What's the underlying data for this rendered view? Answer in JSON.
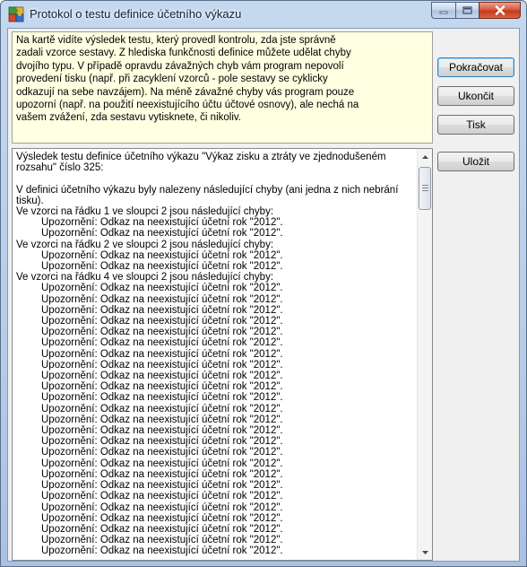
{
  "window": {
    "title": "Protokol o testu definice účetního výkazu",
    "icon": "app-puzzle-icon",
    "caption": {
      "minimize": "minimize-icon",
      "maximize": "maximize-icon",
      "close": "close-icon"
    }
  },
  "info": {
    "lines": [
      "Na kartě vidíte výsledek testu, který provedl kontrolu, zda jste správně",
      "zadali vzorce sestavy. Z hlediska funkčnosti definice můžete udělat chyby",
      "dvojího typu. V případě opravdu závažných chyb vám program nepovolí",
      "provedení tisku (např. při zacyklení vzorců - pole sestavy se cyklicky",
      "odkazují na sebe navzájem). Na méně závažné chyby vás program pouze",
      "upozorní (např. na použití neexistujícího účtu účtové osnovy), ale nechá na",
      "vašem zvážení, zda sestavu vytisknete, či nikoliv."
    ]
  },
  "result": {
    "lines": [
      {
        "text": "Výsledek testu definice účetního výkazu \"Výkaz zisku a ztráty ve zjednodušeném rozsahu\" číslo 325:",
        "indent": false,
        "wrap": true
      },
      {
        "text": "",
        "indent": false
      },
      {
        "text": "V definici účetního výkazu byly nalezeny následující chyby (ani jedna z nich nebrání tisku).",
        "indent": false,
        "wrap": true
      },
      {
        "text": "Ve vzorci na řádku 1 ve sloupci 2 jsou následující chyby:",
        "indent": false
      },
      {
        "text": "Upozornění: Odkaz na neexistující účetní rok \"2012\".",
        "indent": true
      },
      {
        "text": "Upozornění: Odkaz na neexistující účetní rok \"2012\".",
        "indent": true
      },
      {
        "text": "Ve vzorci na řádku 2 ve sloupci 2 jsou následující chyby:",
        "indent": false
      },
      {
        "text": "Upozornění: Odkaz na neexistující účetní rok \"2012\".",
        "indent": true
      },
      {
        "text": "Upozornění: Odkaz na neexistující účetní rok \"2012\".",
        "indent": true
      },
      {
        "text": "Ve vzorci na řádku 4 ve sloupci 2 jsou následující chyby:",
        "indent": false
      },
      {
        "text": "Upozornění: Odkaz na neexistující účetní rok \"2012\".",
        "indent": true
      },
      {
        "text": "Upozornění: Odkaz na neexistující účetní rok \"2012\".",
        "indent": true
      },
      {
        "text": "Upozornění: Odkaz na neexistující účetní rok \"2012\".",
        "indent": true
      },
      {
        "text": "Upozornění: Odkaz na neexistující účetní rok \"2012\".",
        "indent": true
      },
      {
        "text": "Upozornění: Odkaz na neexistující účetní rok \"2012\".",
        "indent": true
      },
      {
        "text": "Upozornění: Odkaz na neexistující účetní rok \"2012\".",
        "indent": true
      },
      {
        "text": "Upozornění: Odkaz na neexistující účetní rok \"2012\".",
        "indent": true
      },
      {
        "text": "Upozornění: Odkaz na neexistující účetní rok \"2012\".",
        "indent": true
      },
      {
        "text": "Upozornění: Odkaz na neexistující účetní rok \"2012\".",
        "indent": true
      },
      {
        "text": "Upozornění: Odkaz na neexistující účetní rok \"2012\".",
        "indent": true
      },
      {
        "text": "Upozornění: Odkaz na neexistující účetní rok \"2012\".",
        "indent": true
      },
      {
        "text": "Upozornění: Odkaz na neexistující účetní rok \"2012\".",
        "indent": true
      },
      {
        "text": "Upozornění: Odkaz na neexistující účetní rok \"2012\".",
        "indent": true
      },
      {
        "text": "Upozornění: Odkaz na neexistující účetní rok \"2012\".",
        "indent": true
      },
      {
        "text": "Upozornění: Odkaz na neexistující účetní rok \"2012\".",
        "indent": true
      },
      {
        "text": "Upozornění: Odkaz na neexistující účetní rok \"2012\".",
        "indent": true
      },
      {
        "text": "Upozornění: Odkaz na neexistující účetní rok \"2012\".",
        "indent": true
      },
      {
        "text": "Upozornění: Odkaz na neexistující účetní rok \"2012\".",
        "indent": true
      },
      {
        "text": "Upozornění: Odkaz na neexistující účetní rok \"2012\".",
        "indent": true
      },
      {
        "text": "Upozornění: Odkaz na neexistující účetní rok \"2012\".",
        "indent": true
      },
      {
        "text": "Upozornění: Odkaz na neexistující účetní rok \"2012\".",
        "indent": true
      },
      {
        "text": "Upozornění: Odkaz na neexistující účetní rok \"2012\".",
        "indent": true
      },
      {
        "text": "Upozornění: Odkaz na neexistující účetní rok \"2012\".",
        "indent": true
      },
      {
        "text": "Upozornění: Odkaz na neexistující účetní rok \"2012\".",
        "indent": true
      },
      {
        "text": "Upozornění: Odkaz na neexistující účetní rok \"2012\".",
        "indent": true
      }
    ]
  },
  "buttons": {
    "continue": "Pokračovat",
    "quit": "Ukončit",
    "print": "Tisk",
    "save": "Uložit"
  },
  "colors": {
    "info_background": "#ffffe1",
    "close_button": "#c3371c"
  }
}
